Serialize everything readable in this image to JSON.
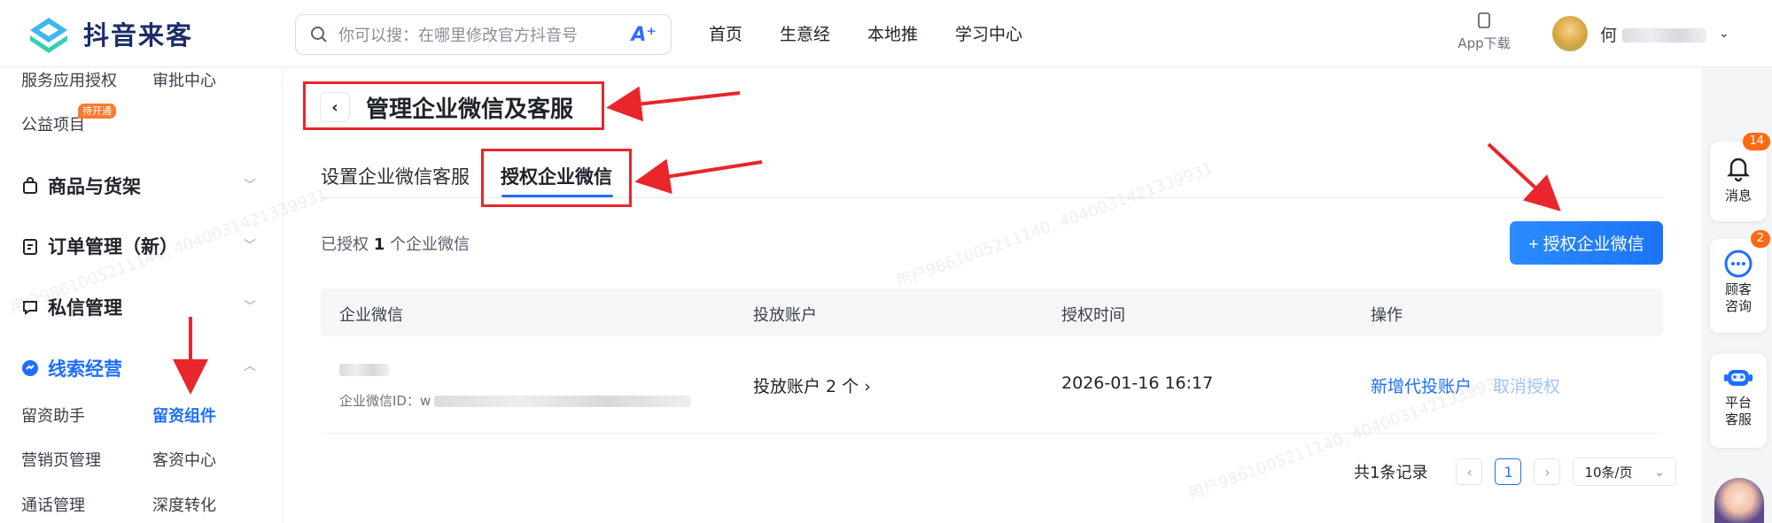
{
  "brand": {
    "name": "抖音来客"
  },
  "search": {
    "placeholder": "你可以搜：在哪里修改官方抖音号",
    "ai_label": "A⁺"
  },
  "top_nav": [
    "首页",
    "生意经",
    "本地推",
    "学习中心"
  ],
  "app_download": "App下载",
  "user": {
    "name": "何"
  },
  "sidebar": {
    "items_top": [
      {
        "label": "服务应用授权"
      },
      {
        "label": "审批中心"
      },
      {
        "label": "公益项目",
        "badge": "待开通"
      }
    ],
    "groups": [
      {
        "label": "商品与货架",
        "icon": "bag-icon"
      },
      {
        "label": "订单管理（新）",
        "icon": "clipboard-icon"
      },
      {
        "label": "私信管理",
        "icon": "chat-icon"
      },
      {
        "label": "线索经营",
        "icon": "leads-icon",
        "active": true
      }
    ],
    "lead_items": [
      {
        "label": "留资助手"
      },
      {
        "label": "留资组件",
        "active": true
      },
      {
        "label": "营销页管理"
      },
      {
        "label": "客资中心"
      },
      {
        "label": "通话管理"
      },
      {
        "label": "深度转化"
      }
    ]
  },
  "page": {
    "title": "管理企业微信及客服",
    "tabs": [
      {
        "label": "设置企业微信客服"
      },
      {
        "label": "授权企业微信",
        "active": true
      }
    ],
    "count_prefix": "已授权",
    "count_value": "1",
    "count_suffix": "个企业微信",
    "primary_button": "+ 授权企业微信"
  },
  "table": {
    "columns": [
      "企业微信",
      "投放账户",
      "授权时间",
      "操作"
    ],
    "rows": [
      {
        "corp_name": "",
        "corp_id_label": "企业微信ID：",
        "corp_id_value": "w",
        "accounts": "投放账户 2 个",
        "time": "2026-01-16 16:17",
        "actions": [
          "新增代投账户",
          "取消授权"
        ]
      }
    ]
  },
  "pagination": {
    "total": "共1条记录",
    "current": "1",
    "page_size": "10条/页"
  },
  "right_rail": [
    {
      "label": "消息",
      "badge": "14",
      "icon": "bell-icon"
    },
    {
      "label": "顾客咨询",
      "badge": "2",
      "icon": "chat-bubble-icon"
    },
    {
      "label": "平台客服",
      "icon": "robot-icon"
    }
  ],
  "watermark": "用户9861005211140, 4040031421339931",
  "colors": {
    "accent": "#1f6fff",
    "annotation": "#e8262b",
    "badge": "#ff6a13"
  }
}
